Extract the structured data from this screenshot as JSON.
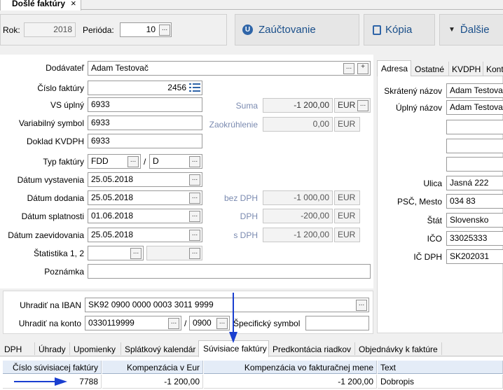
{
  "doc_tab": {
    "title": "Došlé faktúry",
    "close": "×"
  },
  "header": {
    "rok_label": "Rok:",
    "rok_value": "2018",
    "perioda_label": "Perióda:",
    "perioda_value": "10",
    "browse": "..."
  },
  "toolbar": {
    "zauctovanie": "Zaúčtovanie",
    "kopia": "Kópia",
    "dalsie": "Ďalšie"
  },
  "form": {
    "dodavatel_label": "Dodávateľ",
    "dodavatel_value": "Adam Testovač",
    "cislo_label": "Číslo faktúry",
    "cislo_value": "2456",
    "vs_uplny_label": "VS úplný",
    "vs_uplny_value": "6933",
    "vs_label": "Variabilný symbol",
    "vs_value": "6933",
    "kvdph_label": "Doklad KVDPH",
    "kvdph_value": "6933",
    "typ_label": "Typ faktúry",
    "typ_value": "FDD",
    "typ_slash": "/",
    "typ_value2": "D",
    "vystavenie_label": "Dátum vystavenia",
    "vystavenie_value": "25.05.2018",
    "dodanie_label": "Dátum dodania",
    "dodanie_value": "25.05.2018",
    "splatnost_label": "Dátum splatnosti",
    "splatnost_value": "01.06.2018",
    "zaevidovanie_label": "Dátum zaevidovania",
    "zaevidovanie_value": "25.05.2018",
    "statistika_label": "Štatistika 1, 2",
    "poznamka_label": "Poznámka",
    "poznamka_value": ""
  },
  "amounts": {
    "suma_label": "Suma",
    "suma_value": "-1 200,00",
    "suma_cur": "EUR",
    "zaokr_label": "Zaokrúhlenie",
    "zaokr_value": "0,00",
    "zaokr_cur": "EUR",
    "bezdph_label": "bez DPH",
    "bezdph_value": "-1 000,00",
    "bezdph_cur": "EUR",
    "dph_label": "DPH",
    "dph_value": "-200,00",
    "dph_cur": "EUR",
    "sdph_label": "s DPH",
    "sdph_value": "-1 200,00",
    "sdph_cur": "EUR"
  },
  "payment": {
    "iban_label": "Uhradiť na IBAN",
    "iban_value": "SK92 0900 0000 0003 3011 9999",
    "konto_label": "Uhradiť na konto",
    "konto_value": "0330119999",
    "konto_slash": "/",
    "bank_value": "0900",
    "specificky_label": "Špecifický symbol",
    "specificky_value": ""
  },
  "right_panel": {
    "tabs": [
      "Adresa",
      "Ostatné",
      "KVDPH",
      "Kont"
    ],
    "skrateny_label": "Skrátený názov",
    "skrateny_value": "Adam Testovač",
    "uplny_label": "Úplný názov",
    "uplny_value": "Adam Testovač",
    "ulica_label": "Ulica",
    "ulica_value": "Jasná 222",
    "psc_label": "PSČ, Mesto",
    "psc_value": "034 83",
    "stat_label": "Štát",
    "stat_value": "Slovensko",
    "ico_label": "IČO",
    "ico_value": "33025333",
    "icdph_label": "IČ DPH",
    "icdph_value": "SK202031"
  },
  "bottom_tabs": [
    "DPH",
    "Úhrady",
    "Upomienky",
    "Splátkový kalendár",
    "Súvisiace faktúry",
    "Predkontácia riadkov",
    "Objednávky k faktúre"
  ],
  "grid": {
    "columns": [
      "Číslo súvisiacej faktúry",
      "Kompenzácia v Eur",
      "Kompenzácia vo fakturačnej mene",
      "Text"
    ],
    "rows": [
      [
        "7788",
        "-1 200,00",
        "-1 200,00",
        "Dobropis"
      ]
    ]
  },
  "colors": {
    "accent": "#1a4f8a",
    "arrow": "#1a3fd0"
  }
}
